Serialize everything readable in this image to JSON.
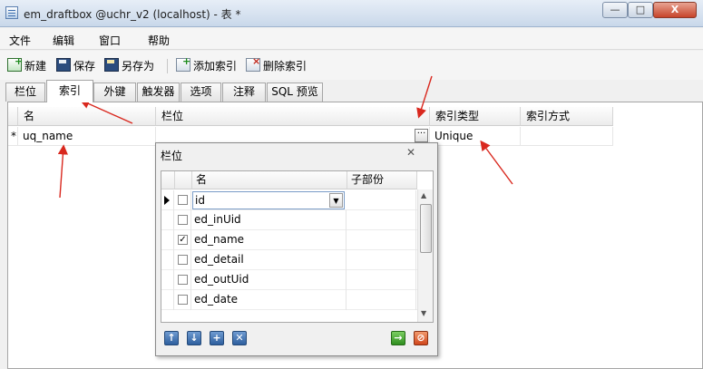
{
  "window": {
    "title": "em_draftbox @uchr_v2 (localhost) - 表 *",
    "min_glyph": "—",
    "max_glyph": "□",
    "close_glyph": "X"
  },
  "menu": [
    "文件",
    "编辑",
    "窗口",
    "帮助"
  ],
  "toolbar": {
    "new_label": "新建",
    "save_label": "保存",
    "saveas_label": "另存为",
    "add_index_label": "添加索引",
    "delete_index_label": "删除索引"
  },
  "tabs": [
    {
      "label": "栏位",
      "active": false
    },
    {
      "label": "索引",
      "active": true
    },
    {
      "label": "外键",
      "active": false
    },
    {
      "label": "触发器",
      "active": false
    },
    {
      "label": "选项",
      "active": false
    },
    {
      "label": "注释",
      "active": false
    },
    {
      "label": "SQL 预览",
      "active": false
    }
  ],
  "index_grid": {
    "headers": {
      "name": "名",
      "fields": "栏位",
      "index_type": "索引类型",
      "index_method": "索引方式"
    },
    "rows": [
      {
        "marker": "*",
        "name": "uq_name",
        "fields": "",
        "index_type": "Unique",
        "index_method": ""
      }
    ],
    "ellipsis": "···"
  },
  "field_popup": {
    "title": "栏位",
    "close_glyph": "✕",
    "headers": {
      "name": "名",
      "sub_part": "子部份"
    },
    "rows": [
      {
        "name": "id",
        "checked": false,
        "editing": true
      },
      {
        "name": "ed_inUid",
        "checked": false
      },
      {
        "name": "ed_name",
        "checked": true
      },
      {
        "name": "ed_detail",
        "checked": false
      },
      {
        "name": "ed_outUid",
        "checked": false
      },
      {
        "name": "ed_date",
        "checked": false
      }
    ],
    "buttons": {
      "up": "↑",
      "down": "↓",
      "add": "+",
      "remove": "✕",
      "ok": "→",
      "cancel": "⊘"
    },
    "check_mark": "✓",
    "scroll_up": "▲",
    "scroll_down": "▼",
    "combo_arrow": "▼"
  },
  "colors": {
    "annotation_arrow": "#d9281e",
    "accent": "#2e5f9e"
  },
  "icons": [
    "app-table-icon",
    "new-icon",
    "save-icon",
    "saveas-icon",
    "add-index-icon",
    "delete-index-icon"
  ]
}
